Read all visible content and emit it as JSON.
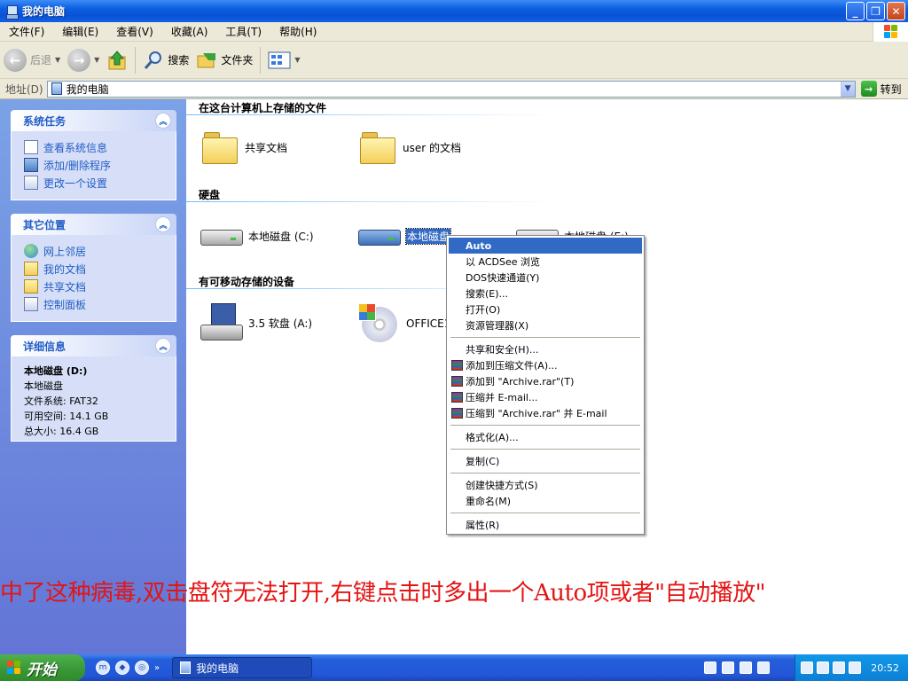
{
  "window": {
    "title": "我的电脑",
    "min": "_",
    "max": "❐",
    "close": "✕"
  },
  "menu": [
    "文件(F)",
    "编辑(E)",
    "查看(V)",
    "收藏(A)",
    "工具(T)",
    "帮助(H)"
  ],
  "toolbar": {
    "back": "后退",
    "search": "搜索",
    "folders": "文件夹"
  },
  "address": {
    "label": "地址(D)",
    "value": "我的电脑",
    "go": "转到"
  },
  "tasks": {
    "system": {
      "title": "系统任务",
      "items": [
        "查看系统信息",
        "添加/删除程序",
        "更改一个设置"
      ]
    },
    "places": {
      "title": "其它位置",
      "items": [
        "网上邻居",
        "我的文档",
        "共享文档",
        "控制面板"
      ]
    },
    "details": {
      "title": "详细信息",
      "name": "本地磁盘 (D:)",
      "type": "本地磁盘",
      "fs": "文件系统: FAT32",
      "free": "可用空间: 14.1 GB",
      "total": "总大小: 16.4 GB"
    }
  },
  "content": {
    "sec_files": "在这台计算机上存储的文件",
    "shared_docs": "共享文档",
    "user_docs": "user 的文档",
    "sec_hdd": "硬盘",
    "drive_c": "本地磁盘 (C:)",
    "drive_d": "本地磁盘",
    "drive_e": "本地磁盘 (E:)",
    "sec_removable": "有可移动存储的设备",
    "floppy": "3.5 软盘 (A:)",
    "cdrom": "OFFICE11"
  },
  "context_menu": {
    "auto": "Auto",
    "acdsee": "以 ACDSee 浏览",
    "dos": "DOS快速通道(Y)",
    "search": "搜索(E)...",
    "open": "打开(O)",
    "explorer": "资源管理器(X)",
    "sharing": "共享和安全(H)...",
    "add_archive": "添加到压缩文件(A)...",
    "add_rar": "添加到 \"Archive.rar\"(T)",
    "compress_email": "压缩并 E-mail...",
    "compress_rar_email": "压缩到 \"Archive.rar\" 并 E-mail",
    "format": "格式化(A)...",
    "copy": "复制(C)",
    "shortcut": "创建快捷方式(S)",
    "rename": "重命名(M)",
    "properties": "属性(R)"
  },
  "annotation": "中了这种病毒,双击盘符无法打开,右键点击时多出一个Auto项或者\"自动播放\"",
  "taskbar": {
    "start": "开始",
    "task": "我的电脑",
    "clock": "20:52"
  }
}
